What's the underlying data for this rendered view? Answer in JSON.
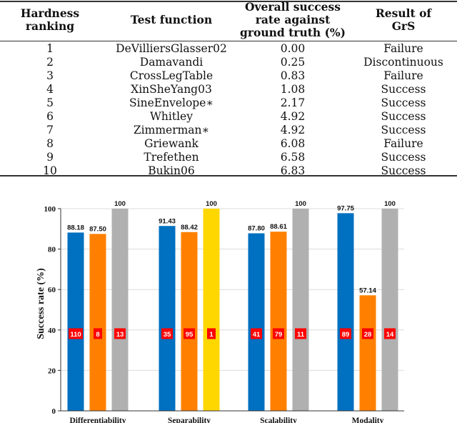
{
  "table": {
    "headers": [
      [
        "Hardness",
        "ranking"
      ],
      [
        "Test function"
      ],
      [
        "Overall success",
        "rate against",
        "ground truth (%)"
      ],
      [
        "Result of",
        "GrS"
      ]
    ],
    "rows": [
      [
        "1",
        "DeVilliersGlasser02",
        "0.00",
        "Failure"
      ],
      [
        "2",
        "Damavandi",
        "0.25",
        "Discontinuous"
      ],
      [
        "3",
        "CrossLegTable",
        "0.83",
        "Failure"
      ],
      [
        "4",
        "XinSheYang03",
        "1.08",
        "Success"
      ],
      [
        "5",
        "SineEnvelope∗",
        "2.17",
        "Success"
      ],
      [
        "6",
        "Whitley",
        "4.92",
        "Success"
      ],
      [
        "7",
        "Zimmerman∗",
        "4.92",
        "Success"
      ],
      [
        "8",
        "Griewank",
        "6.08",
        "Failure"
      ],
      [
        "9",
        "Trefethen",
        "6.58",
        "Success"
      ],
      [
        "10",
        "Bukin06",
        "6.83",
        "Success"
      ]
    ]
  },
  "chart_data": {
    "type": "bar",
    "title": "",
    "xlabel": "",
    "ylabel": "Success rate (%)",
    "ylim": [
      0,
      100
    ],
    "yticks": [
      0,
      20,
      40,
      60,
      80,
      100
    ],
    "grid": true,
    "legend": "none",
    "categories": [
      "Differentiability",
      "Separability",
      "Scalability",
      "Modality"
    ],
    "groups": [
      {
        "category": "Differentiability",
        "bars": [
          {
            "value": 88.18,
            "label": "88.18",
            "count": "110",
            "color": "#0070C0"
          },
          {
            "value": 87.5,
            "label": "87.50",
            "count": "8",
            "color": "#FF8000"
          },
          {
            "value": 100,
            "label": "100",
            "count": "13",
            "color": "#B0B0B0"
          }
        ]
      },
      {
        "category": "Separability",
        "bars": [
          {
            "value": 91.43,
            "label": "91.43",
            "count": "35",
            "color": "#0070C0"
          },
          {
            "value": 88.42,
            "label": "88.42",
            "count": "95",
            "color": "#FF8000"
          },
          {
            "value": 100,
            "label": "100",
            "count": "1",
            "color": "#FFD700"
          }
        ]
      },
      {
        "category": "Scalability",
        "bars": [
          {
            "value": 87.8,
            "label": "87.80",
            "count": "41",
            "color": "#0070C0"
          },
          {
            "value": 88.61,
            "label": "88.61",
            "count": "79",
            "color": "#FF8000"
          },
          {
            "value": 100,
            "label": "100",
            "count": "11",
            "color": "#B0B0B0"
          }
        ]
      },
      {
        "category": "Modality",
        "bars": [
          {
            "value": 97.75,
            "label": "97.75",
            "count": "89",
            "color": "#0070C0"
          },
          {
            "value": 57.14,
            "label": "57.14",
            "count": "28",
            "color": "#FF8000"
          },
          {
            "value": 100,
            "label": "100",
            "count": "14",
            "color": "#B0B0B0"
          }
        ]
      }
    ],
    "count_box_color": "#FF0000",
    "count_box_level": 38
  }
}
